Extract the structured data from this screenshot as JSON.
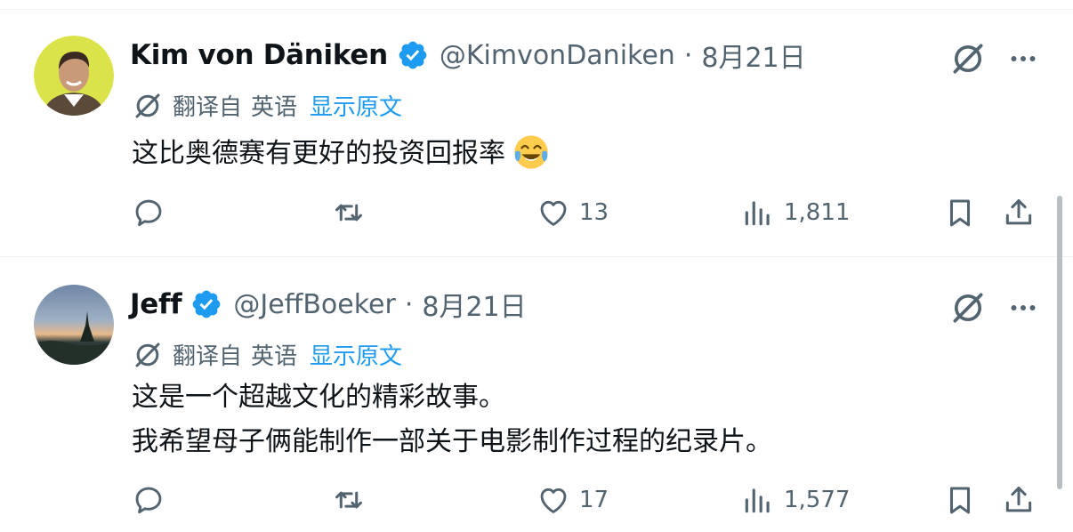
{
  "tweets": [
    {
      "name": "Kim von Däniken",
      "handle": "@KimvonDaniken",
      "separator": "·",
      "date": "8月21日",
      "translated_from": "翻译自",
      "language": "英语",
      "show_original": "显示原文",
      "text_lines": [
        "这比奥德赛有更好的投资回报率"
      ],
      "emoji": "face-with-tears-of-joy",
      "likes": "13",
      "views": "1,811"
    },
    {
      "name": "Jeff",
      "handle": "@JeffBoeker",
      "separator": "·",
      "date": "8月21日",
      "translated_from": "翻译自",
      "language": "英语",
      "show_original": "显示原文",
      "text_lines": [
        "这是一个超越文化的精彩故事。",
        "我希望母子俩能制作一部关于电影制作过程的纪录片。"
      ],
      "likes": "17",
      "views": "1,577"
    }
  ],
  "colors": {
    "text": "#0f1419",
    "secondary": "#536471",
    "link": "#1d9bf0",
    "verified": "#1d9bf0",
    "divider": "#eff3f4"
  }
}
